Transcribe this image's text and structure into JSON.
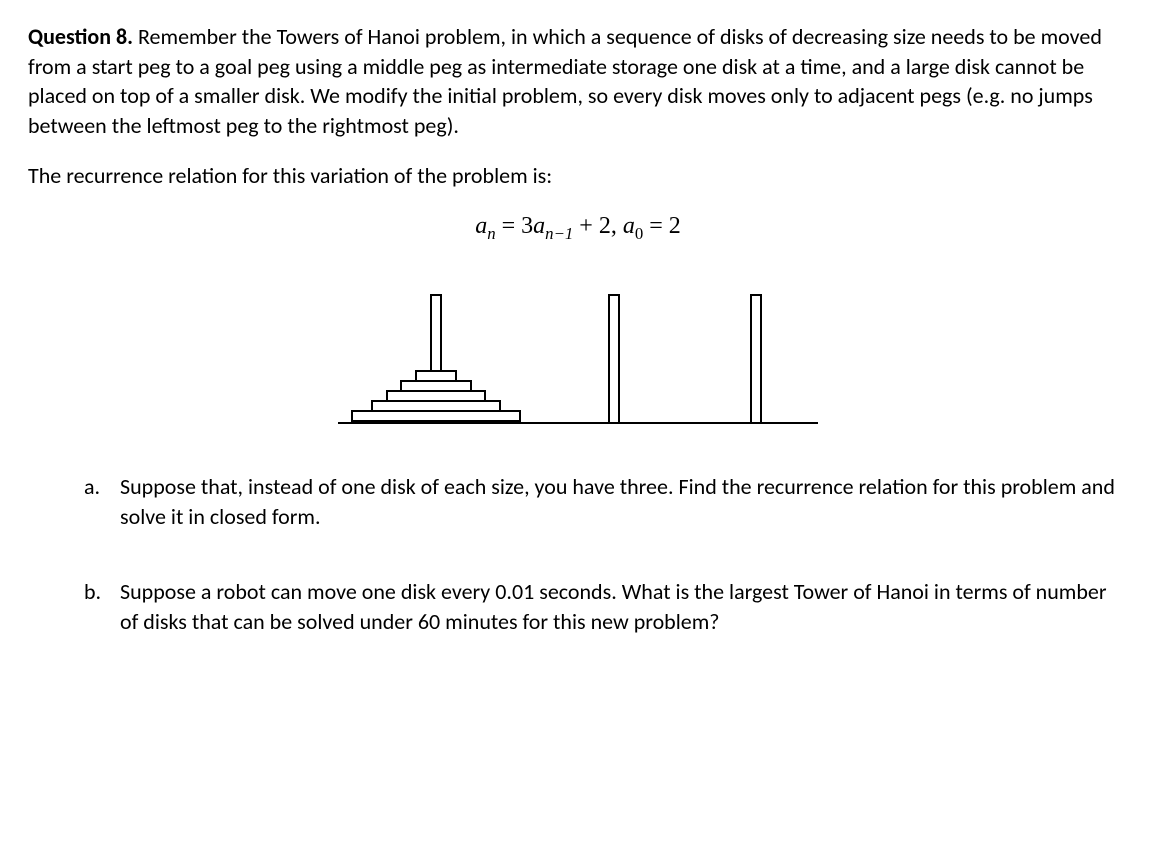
{
  "question": {
    "label": "Question 8.",
    "intro": " Remember the Towers of Hanoi problem, in which a sequence of disks of decreasing size needs to be moved from a start peg to a goal peg using a middle peg as intermediate storage one disk at a time, and a large disk cannot be placed on top of a smaller disk. We modify the initial problem, so every disk moves only to adjacent pegs (e.g.  no jumps between the leftmost peg to the rightmost peg).",
    "leadin": "The recurrence relation for this variation of the problem is:",
    "equation": {
      "a": "a",
      "n": "n",
      "eq1": " = 3",
      "nm1": "n−1",
      "plus2": " + 2, ",
      "zero": "0",
      "eq2": " = 2"
    },
    "parts": [
      {
        "marker": "a.",
        "text": "Suppose that, instead of one disk of each size, you have three. Find the recurrence relation for this problem and solve it in closed form."
      },
      {
        "marker": "b.",
        "text": "Suppose a robot can move one disk every 0.01 seconds. What is the largest Tower of Hanoi in terms of number of disks that can be solved under 60 minutes for this new problem?"
      }
    ]
  }
}
